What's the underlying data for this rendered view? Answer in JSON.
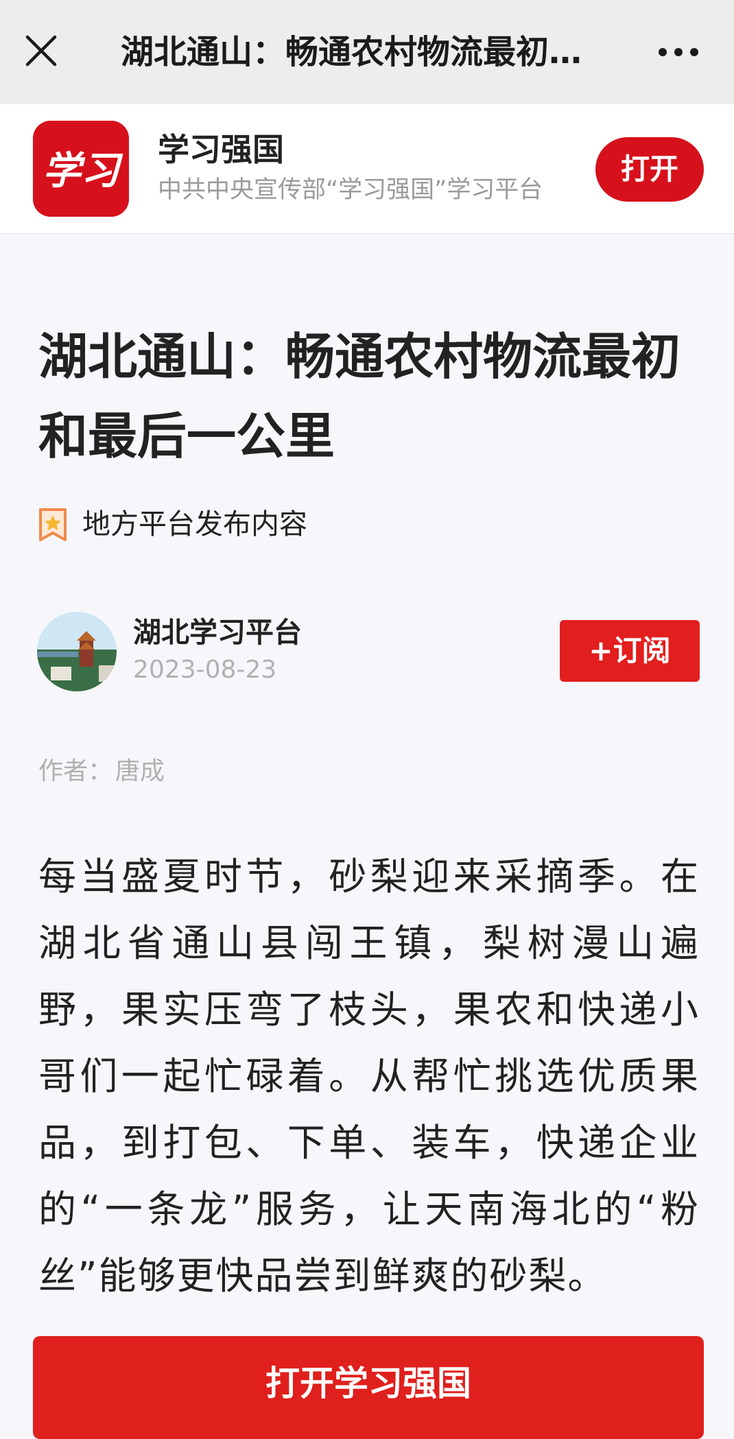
{
  "topbar": {
    "title": "湖北通山：畅通农村物流最初和最后一公里",
    "close_icon": "close-icon",
    "more_icon": "more-horizontal-icon"
  },
  "app_banner": {
    "logo_text": "学习",
    "name": "学习强国",
    "description": "中共中央宣传部“学习强国”学习平台",
    "open_label": "打开"
  },
  "article": {
    "title": "湖北通山：畅通农村物流最初和最后一公里",
    "tag": "地方平台发布内容",
    "publisher": "湖北学习平台",
    "date": "2023-08-23",
    "subscribe_label": "+订阅",
    "author_label": "作者：",
    "author": "唐成",
    "body": "每当盛夏时节，砂梨迎来采摘季。在湖北省通山县闯王镇，梨树漫山遍野，果实压弯了枝头，果农和快递小哥们一起忙碌着。从帮忙挑选优质果品，到打包、下单、装车，快递企业的“一条龙”服务，让天南海北的“粉丝”能够更快品尝到鲜爽的砂梨。"
  },
  "bottom_bar": {
    "open_app_label": "打开学习强国"
  },
  "colors": {
    "brand_red": "#d6111b",
    "button_red": "#e31e1e",
    "topbar_bg": "#ededed",
    "page_bg": "#f7f7fb"
  }
}
